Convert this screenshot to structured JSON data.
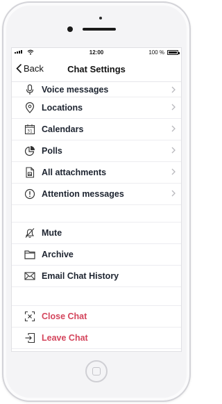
{
  "status_bar": {
    "time": "12:00",
    "battery": "100 %"
  },
  "nav": {
    "back_label": "Back",
    "title": "Chat Settings"
  },
  "section_one": [
    {
      "label": "Voice messages",
      "icon": "microphone-icon"
    },
    {
      "label": "Locations",
      "icon": "location-pin-icon"
    },
    {
      "label": "Calendars",
      "icon": "calendar-icon",
      "icon_text": "31"
    },
    {
      "label": "Polls",
      "icon": "pie-chart-icon"
    },
    {
      "label": "All attachments",
      "icon": "document-icon"
    },
    {
      "label": "Attention messages",
      "icon": "exclamation-circle-icon"
    }
  ],
  "section_two": [
    {
      "label": "Mute",
      "icon": "bell-off-icon"
    },
    {
      "label": "Archive",
      "icon": "folder-icon"
    },
    {
      "label": "Email Chat History",
      "icon": "envelope-icon"
    }
  ],
  "section_three": [
    {
      "label": "Close Chat",
      "icon": "close-chat-icon"
    },
    {
      "label": "Leave Chat",
      "icon": "leave-chat-icon"
    }
  ],
  "colors": {
    "danger": "#d4455c",
    "text": "#1d2430",
    "chevron": "#b8b8bd"
  }
}
